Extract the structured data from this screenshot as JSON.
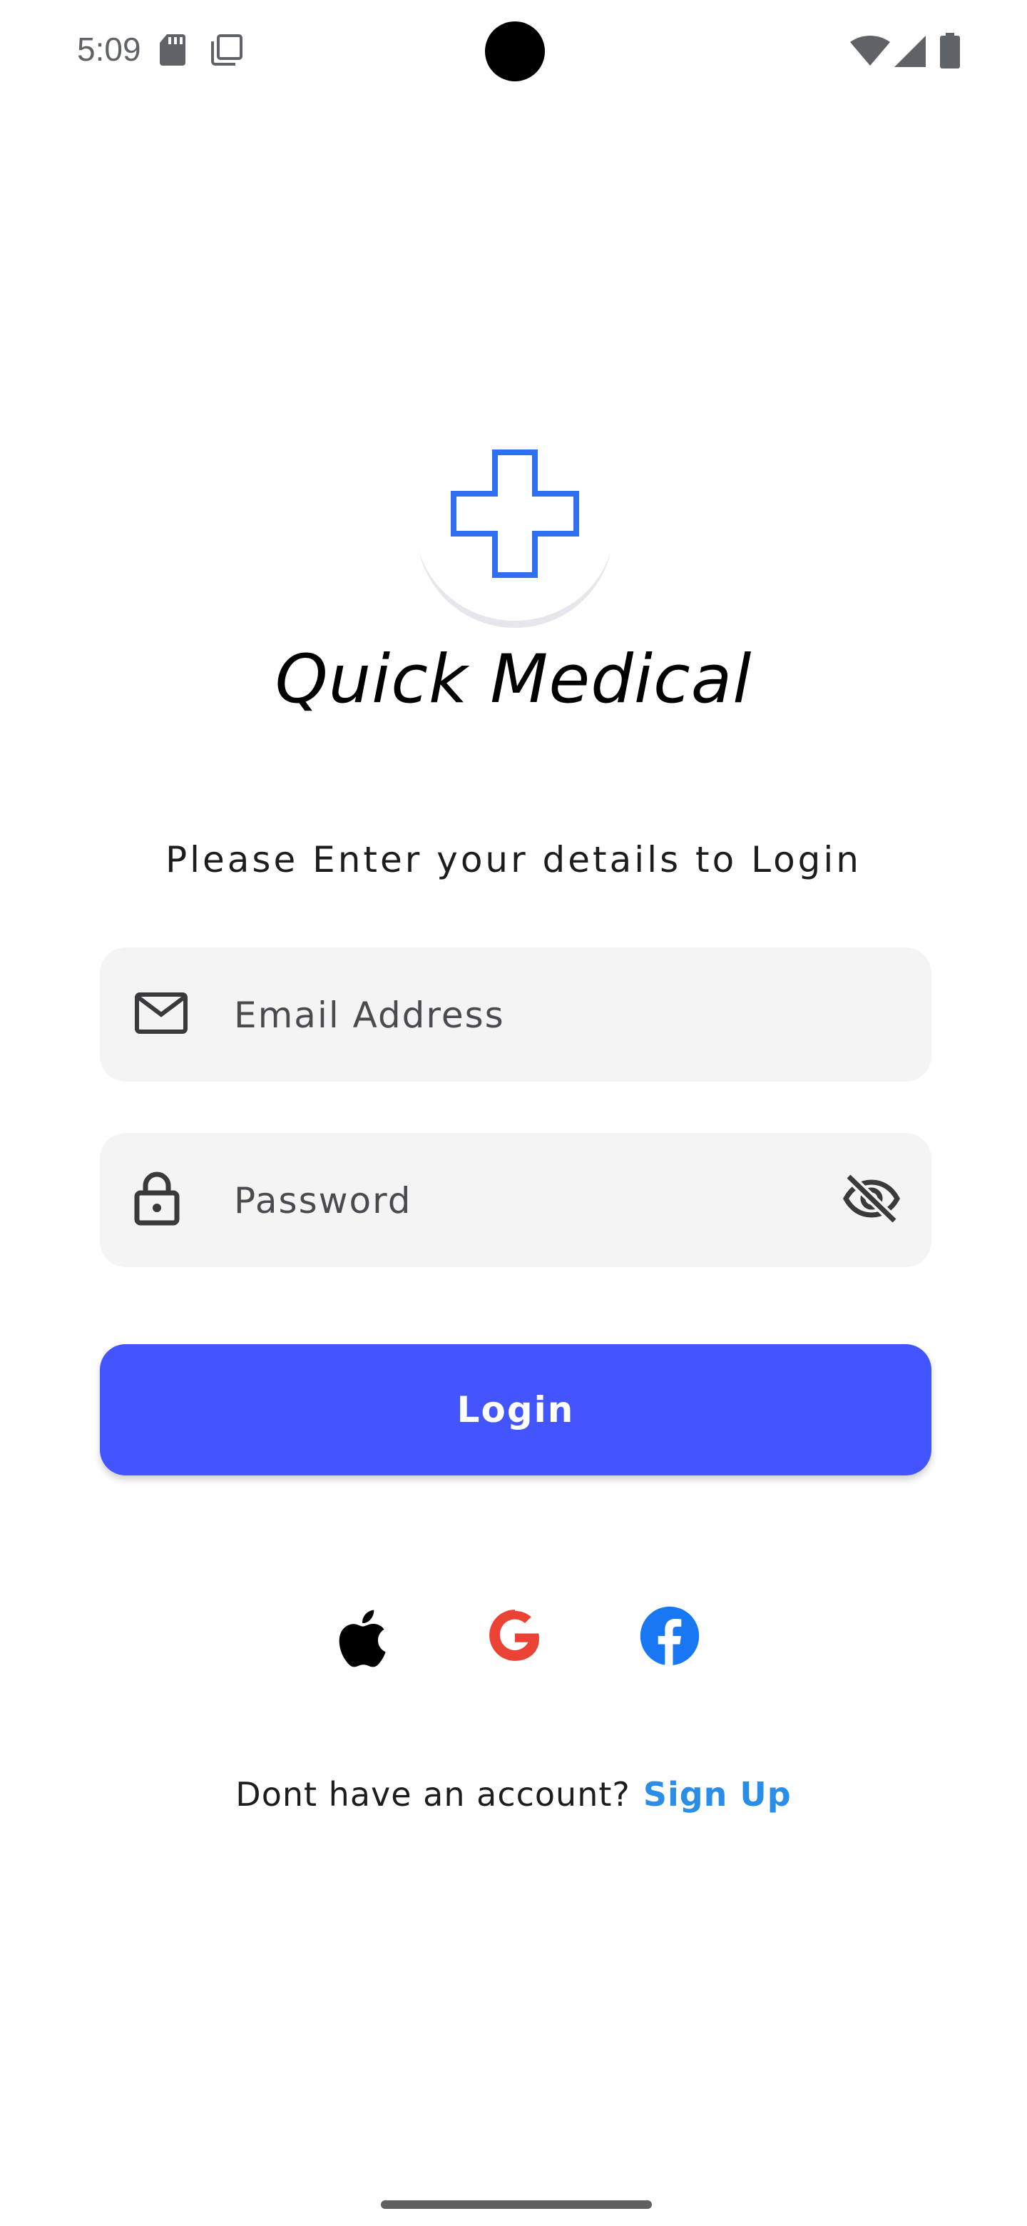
{
  "status_bar": {
    "time": "5:09",
    "icons_left": [
      "sd-card-icon",
      "screenshot-icon"
    ],
    "icons_right": [
      "wifi-icon",
      "signal-icon",
      "battery-icon"
    ]
  },
  "logo": {
    "icon": "medical-cross-icon",
    "color": "#2f6ff2"
  },
  "app": {
    "title": "Quick Medical"
  },
  "login_form": {
    "subtitle": "Please Enter your details to Login",
    "email": {
      "icon": "mail-icon",
      "placeholder": "Email Address",
      "value": ""
    },
    "password": {
      "icon": "lock-icon",
      "placeholder": "Password",
      "value": "",
      "toggle_icon": "eye-off-icon"
    },
    "submit_label": "Login",
    "submit_color": "#4355ff"
  },
  "social_login": {
    "providers": [
      {
        "name": "Apple",
        "icon": "apple-icon",
        "color": "#000000"
      },
      {
        "name": "Google",
        "icon": "google-icon",
        "color": "#ea4335"
      },
      {
        "name": "Facebook",
        "icon": "facebook-icon",
        "color": "#1877f2"
      }
    ]
  },
  "signup": {
    "prompt": "Dont have an account?",
    "link_label": "Sign Up",
    "link_color": "#2a8de8"
  }
}
